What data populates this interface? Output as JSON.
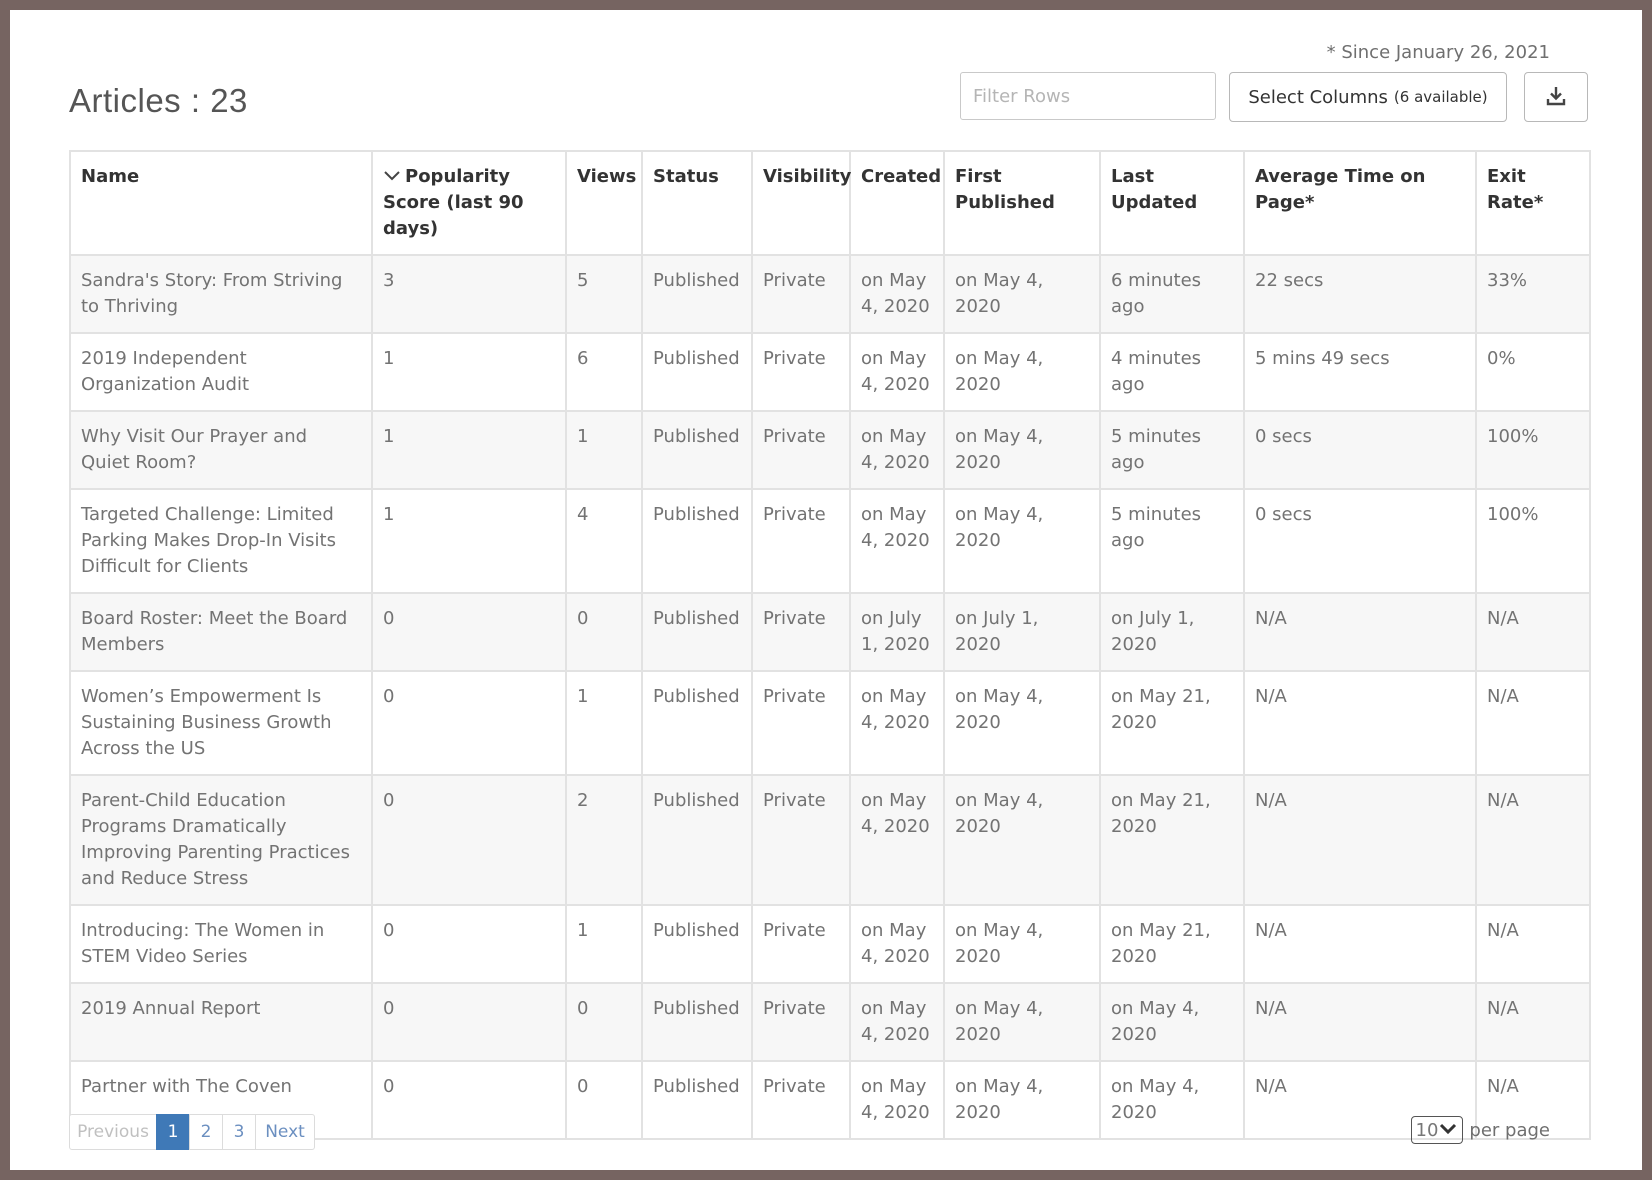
{
  "header": {
    "since_note": "* Since January 26, 2021",
    "title": "Articles : 23",
    "filter_placeholder": "Filter Rows",
    "select_columns_label": "Select Columns",
    "select_columns_count": "(6 available)"
  },
  "table": {
    "columns": [
      {
        "label": "Name"
      },
      {
        "label": "Popularity Score (last 90 days)"
      },
      {
        "label": "Views"
      },
      {
        "label": "Status"
      },
      {
        "label": "Visibility"
      },
      {
        "label": "Created"
      },
      {
        "label": "First Published"
      },
      {
        "label": "Last Updated"
      },
      {
        "label": "Average Time on Page*"
      },
      {
        "label": "Exit Rate*"
      }
    ],
    "rows": [
      [
        "Sandra's Story: From Striving to Thriving",
        "3",
        "5",
        "Published",
        "Private",
        "on May 4, 2020",
        "on May 4, 2020",
        "6 minutes ago",
        "22 secs",
        "33%"
      ],
      [
        "2019 Independent Organization Audit",
        "1",
        "6",
        "Published",
        "Private",
        "on May 4, 2020",
        "on May 4, 2020",
        "4 minutes ago",
        "5 mins 49 secs",
        "0%"
      ],
      [
        "Why Visit Our Prayer and Quiet Room?",
        "1",
        "1",
        "Published",
        "Private",
        "on May 4, 2020",
        "on May 4, 2020",
        "5 minutes ago",
        "0 secs",
        "100%"
      ],
      [
        "Targeted Challenge: Limited Parking Makes Drop-In Visits Difficult for Clients",
        "1",
        "4",
        "Published",
        "Private",
        "on May 4, 2020",
        "on May 4, 2020",
        "5 minutes ago",
        "0 secs",
        "100%"
      ],
      [
        "Board Roster: Meet the Board Members",
        "0",
        "0",
        "Published",
        "Private",
        "on July 1, 2020",
        "on July 1, 2020",
        "on July 1, 2020",
        "N/A",
        "N/A"
      ],
      [
        "Women’s Empowerment Is Sustaining Business Growth Across the US",
        "0",
        "1",
        "Published",
        "Private",
        "on May 4, 2020",
        "on May 4, 2020",
        "on May 21, 2020",
        "N/A",
        "N/A"
      ],
      [
        "Parent-Child Education Programs Dramatically Improving Parenting Practices and Reduce Stress",
        "0",
        "2",
        "Published",
        "Private",
        "on May 4, 2020",
        "on May 4, 2020",
        "on May 21, 2020",
        "N/A",
        "N/A"
      ],
      [
        "Introducing: The Women in STEM Video Series",
        "0",
        "1",
        "Published",
        "Private",
        "on May 4, 2020",
        "on May 4, 2020",
        "on May 21, 2020",
        "N/A",
        "N/A"
      ],
      [
        "2019 Annual Report",
        "0",
        "0",
        "Published",
        "Private",
        "on May 4, 2020",
        "on May 4, 2020",
        "on May 4, 2020",
        "N/A",
        "N/A"
      ],
      [
        "Partner with The Coven",
        "0",
        "0",
        "Published",
        "Private",
        "on May 4, 2020",
        "on May 4, 2020",
        "on May 4, 2020",
        "N/A",
        "N/A"
      ]
    ]
  },
  "pagination": {
    "previous": "Previous",
    "pages": [
      "1",
      "2",
      "3"
    ],
    "active_page": "1",
    "next": "Next"
  },
  "per_page": {
    "value": "10",
    "label": "per page"
  },
  "icons": {
    "sort": "chevron-down-icon",
    "download": "download-icon",
    "per_page_dropdown": "chevron-down-icon"
  },
  "colors": {
    "accent": "#3f79b7",
    "link": "#6b8fc0",
    "border_frame": "#766461"
  }
}
